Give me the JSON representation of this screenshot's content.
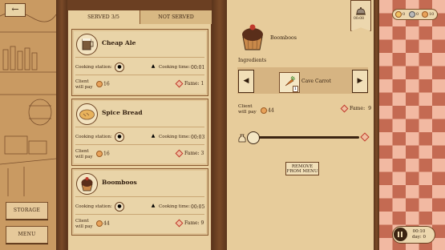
{
  "nav": {
    "back_icon": "back-arrow-icon",
    "storage_label": "STORAGE",
    "menu_label": "MENU"
  },
  "tabs": [
    {
      "label": "SERVED 3/5",
      "active": true
    },
    {
      "label": "NOT SERVED",
      "active": false
    }
  ],
  "labels": {
    "station": "Cooking station:",
    "time": "Cooking time:",
    "client_pay": "Client will pay",
    "fame": "Fame:"
  },
  "dishes": [
    {
      "name": "Cheap Ale",
      "time": "00:01",
      "pay": "16",
      "fame": "1",
      "icon": "ale-mug-icon",
      "station_icon": "barrel-icon"
    },
    {
      "name": "Spice Bread",
      "time": "00:03",
      "pay": "16",
      "fame": "3",
      "icon": "bread-icon",
      "station_icon": "oven-icon"
    },
    {
      "name": "Boomboos",
      "time": "00:05",
      "pay": "44",
      "fame": "9",
      "icon": "cupcake-icon",
      "station_icon": "pot-icon"
    }
  ],
  "detail": {
    "name": "Boomboos",
    "ingredients_label": "Ingredients",
    "ingredient": {
      "name": "Cave Carrot",
      "count": "1",
      "icon": "carrot-icon"
    },
    "client_pay_label": "Client will pay",
    "pay": "44",
    "fame_label": "Fame:",
    "fame": "9",
    "price_slider_level": 0,
    "remove_label": "REMOVE FROM MENU"
  },
  "top_right": {
    "bell_time": "00:08",
    "currencies": [
      "0",
      "0",
      "10"
    ]
  },
  "clock": {
    "time": "00:10",
    "day": "day: 0"
  },
  "colors": {
    "panel": "#e8cf9f",
    "wood": "#6b3f22",
    "checker_dark": "#c46a52",
    "checker_light": "#f2b9a2"
  }
}
